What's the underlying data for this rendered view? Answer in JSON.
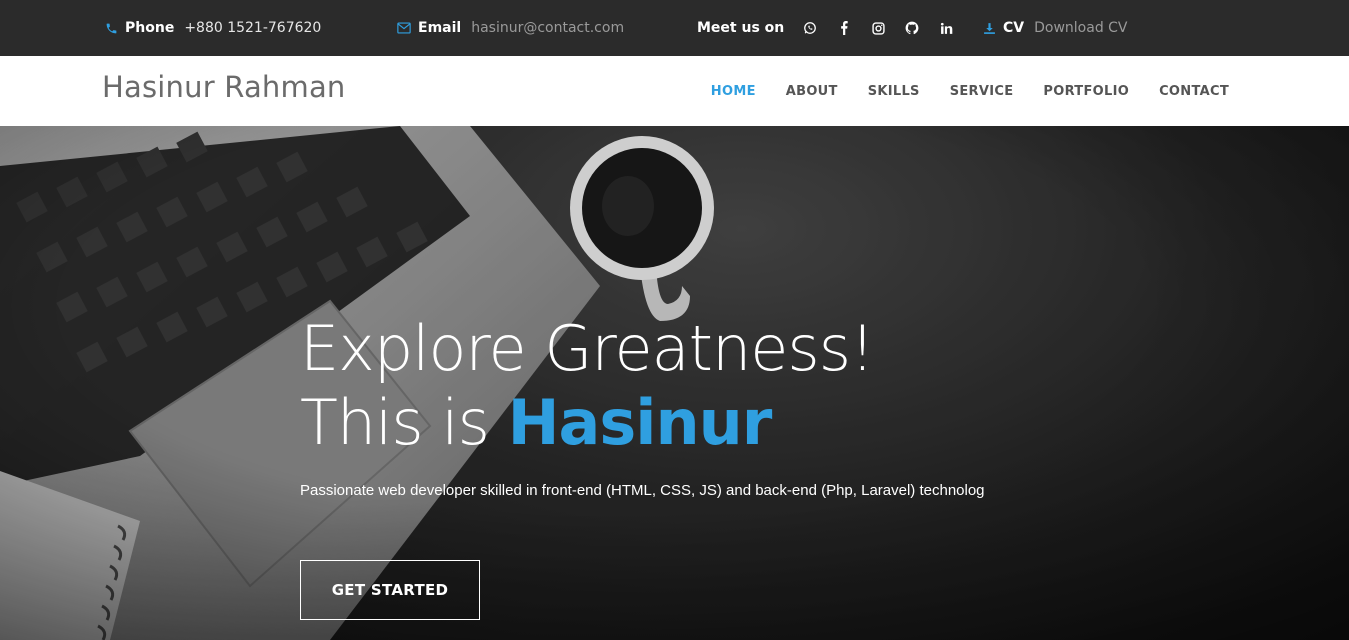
{
  "topbar": {
    "phone": {
      "label": "Phone",
      "value": "+880 1521-767620"
    },
    "email": {
      "label": "Email",
      "value": "hasinur@contact.com"
    },
    "social": {
      "label": "Meet us on",
      "icons": [
        "whatsapp-icon",
        "facebook-icon",
        "instagram-icon",
        "github-icon",
        "linkedin-icon"
      ]
    },
    "cv": {
      "label": "CV",
      "value": "Download CV"
    }
  },
  "header": {
    "brand": "Hasinur Rahman",
    "nav": [
      "HOME",
      "ABOUT",
      "SKILLS",
      "SERVICE",
      "PORTFOLIO",
      "CONTACT"
    ],
    "active": "HOME"
  },
  "hero": {
    "title_line1": "Explore Greatness!",
    "title_line2_prefix": "This is ",
    "title_line2_accent": "Hasinur",
    "subtitle": "Passionate web developer skilled in front-end (HTML, CSS, JS) and back-end (Php, Laravel) technolog",
    "cta": "GET STARTED"
  },
  "colors": {
    "accent": "#2f9fe0",
    "topbar_bg": "#2b2b2b"
  }
}
